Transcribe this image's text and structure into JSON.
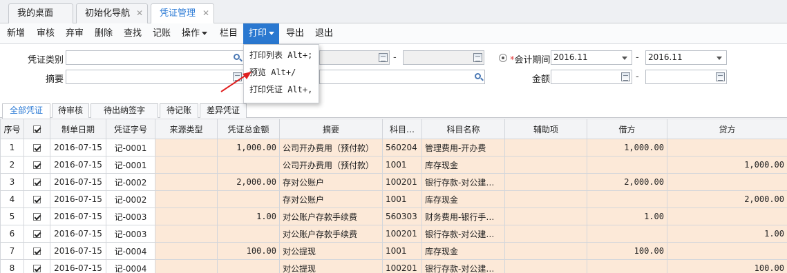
{
  "tabs": [
    {
      "label": "我的桌面",
      "closable": false
    },
    {
      "label": "初始化导航",
      "closable": true
    },
    {
      "label": "凭证管理",
      "closable": true,
      "active": true
    }
  ],
  "toolbar": [
    "新增",
    "审核",
    "弃审",
    "删除",
    "查找",
    "记账",
    "操作",
    "栏目",
    "打印",
    "导出",
    "退出"
  ],
  "filter": {
    "voucher_type_label": "凭证类别",
    "summary_label": "摘要",
    "period_label": "会计期间",
    "period_from": "2016.11",
    "period_to": "2016.11",
    "amount_label": "金额",
    "dash": "-"
  },
  "print_menu": [
    "打印列表 Alt+;",
    "预览 Alt+/",
    "打印凭证 Alt+,"
  ],
  "status_tabs": [
    "全部凭证",
    "待审核",
    "待出纳签字",
    "待记账",
    "差异凭证"
  ],
  "columns": [
    "序号",
    "",
    "制单日期",
    "凭证字号",
    "来源类型",
    "凭证总金额",
    "摘要",
    "科目…",
    "科目名称",
    "辅助项",
    "借方",
    "贷方"
  ],
  "rows": [
    [
      "1",
      "2016-07-15",
      "记-0001",
      "",
      "1,000.00",
      "公司开办费用（预付款）",
      "560204",
      "管理费用-开办费",
      "",
      "1,000.00",
      ""
    ],
    [
      "2",
      "2016-07-15",
      "记-0001",
      "",
      "",
      "公司开办费用（预付款）",
      "1001",
      "库存现金",
      "",
      "",
      "1,000.00"
    ],
    [
      "3",
      "2016-07-15",
      "记-0002",
      "",
      "2,000.00",
      "存对公账户",
      "100201",
      "银行存款-对公建…",
      "",
      "2,000.00",
      ""
    ],
    [
      "4",
      "2016-07-15",
      "记-0002",
      "",
      "",
      "存对公账户",
      "1001",
      "库存现金",
      "",
      "",
      "2,000.00"
    ],
    [
      "5",
      "2016-07-15",
      "记-0003",
      "",
      "1.00",
      "对公账户存款手续费",
      "560303",
      "财务费用-银行手…",
      "",
      "1.00",
      ""
    ],
    [
      "6",
      "2016-07-15",
      "记-0003",
      "",
      "",
      "对公账户存款手续费",
      "100201",
      "银行存款-对公建…",
      "",
      "",
      "1.00"
    ],
    [
      "7",
      "2016-07-15",
      "记-0004",
      "",
      "100.00",
      "对公提现",
      "1001",
      "库存现金",
      "",
      "100.00",
      ""
    ],
    [
      "8",
      "2016-07-15",
      "记-0004",
      "",
      "",
      "对公提现",
      "100201",
      "银行存款-对公建…",
      "",
      "",
      "100.00"
    ]
  ],
  "colors": {
    "accent": "#2a78d0",
    "row_highlight": "#fce9d8",
    "arrow": "#e02020"
  }
}
